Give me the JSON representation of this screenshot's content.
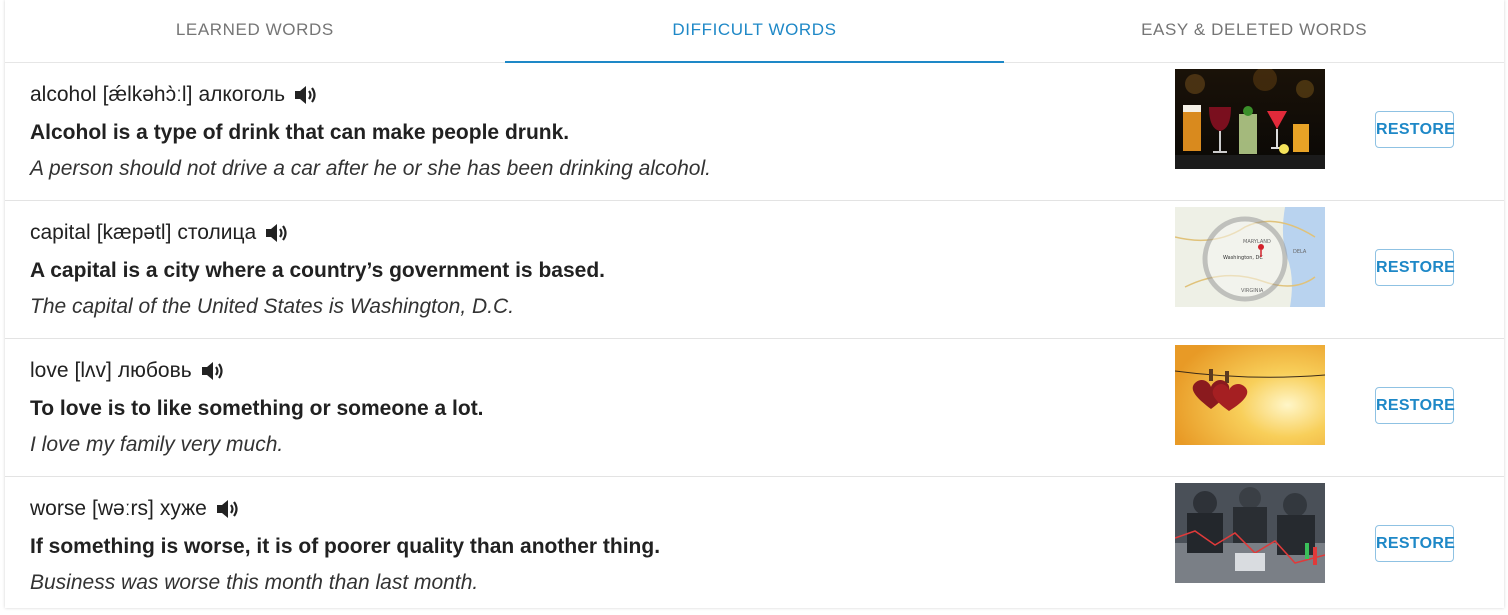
{
  "tabs": [
    {
      "label": "LEARNED WORDS",
      "active": false
    },
    {
      "label": "DIFFICULT WORDS",
      "active": true
    },
    {
      "label": "EASY & DELETED WORDS",
      "active": false
    }
  ],
  "accent_color": "#1e88c7",
  "words": [
    {
      "word": "alcohol",
      "transcription": "[ǽlkəhɔ̀ːl]",
      "translation": "алкоголь",
      "definition": "Alcohol is a type of drink that can make people drunk.",
      "example": "A person should not drive a car after he or she has been drinking alcohol.",
      "image": "drinks-photo",
      "button": "RESTORE"
    },
    {
      "word": "capital",
      "transcription": "[kæpətl]",
      "translation": "столица",
      "definition": "A capital is a city where a country’s government is based.",
      "example": "The capital of the United States is Washington, D.C.",
      "image": "map-magnifier-photo",
      "image_text": [
        "MARYLAND",
        "Washington, DC",
        "VIRGINIA",
        "DELA"
      ],
      "button": "RESTORE"
    },
    {
      "word": "love",
      "transcription": "[lʌv]",
      "translation": "любовь",
      "definition": "To love is to like something or someone a lot.",
      "example": "I love my family very much.",
      "image": "hearts-on-line-photo",
      "button": "RESTORE"
    },
    {
      "word": "worse",
      "transcription": "[wəːrs]",
      "translation": "хуже",
      "definition": "If something is worse, it is of poorer quality than another thing.",
      "example": "Business was worse this month than last month.",
      "image": "business-meeting-photo",
      "button": "RESTORE"
    }
  ]
}
